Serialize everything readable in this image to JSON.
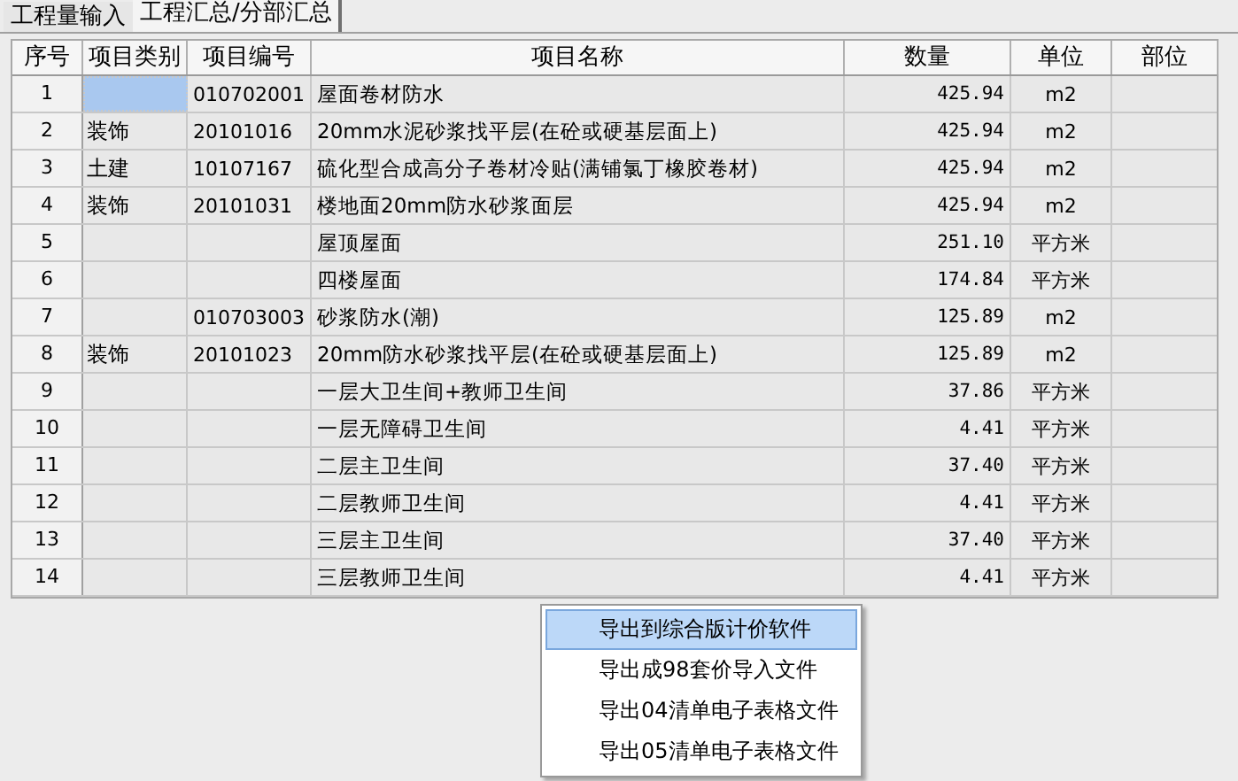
{
  "tabs": [
    {
      "label": "工程量输入",
      "selected": false
    },
    {
      "label": "工程汇总/分部汇总",
      "selected": true
    }
  ],
  "table": {
    "columns": [
      "序号",
      "项目类别",
      "项目编号",
      "项目名称",
      "数量",
      "单位",
      "部位"
    ],
    "rows": [
      {
        "seq": "1",
        "category": "",
        "code": "010702001",
        "name": "屋面卷材防水",
        "quantity": "425.94",
        "unit": "m2",
        "selected": true
      },
      {
        "seq": "2",
        "category": "装饰",
        "code": "20101016",
        "name": "20mm水泥砂浆找平层(在砼或硬基层面上)",
        "quantity": "425.94",
        "unit": "m2",
        "selected": false
      },
      {
        "seq": "3",
        "category": "土建",
        "code": "10107167",
        "name": "硫化型合成高分子卷材冷贴(满铺氯丁橡胶卷材)",
        "quantity": "425.94",
        "unit": "m2",
        "selected": false
      },
      {
        "seq": "4",
        "category": "装饰",
        "code": "20101031",
        "name": "楼地面20mm防水砂浆面层",
        "quantity": "425.94",
        "unit": "m2",
        "selected": false
      },
      {
        "seq": "5",
        "category": "",
        "code": "",
        "name": "屋顶屋面",
        "quantity": "251.10",
        "unit": "平方米",
        "selected": false
      },
      {
        "seq": "6",
        "category": "",
        "code": "",
        "name": "四楼屋面",
        "quantity": "174.84",
        "unit": "平方米",
        "selected": false
      },
      {
        "seq": "7",
        "category": "",
        "code": "010703003",
        "name": "砂浆防水(潮)",
        "quantity": "125.89",
        "unit": "m2",
        "selected": false
      },
      {
        "seq": "8",
        "category": "装饰",
        "code": "20101023",
        "name": "20mm防水砂浆找平层(在砼或硬基层面上)",
        "quantity": "125.89",
        "unit": "m2",
        "selected": false
      },
      {
        "seq": "9",
        "category": "",
        "code": "",
        "name": "一层大卫生间+教师卫生间",
        "quantity": "37.86",
        "unit": "平方米",
        "selected": false
      },
      {
        "seq": "10",
        "category": "",
        "code": "",
        "name": "一层无障碍卫生间",
        "quantity": "4.41",
        "unit": "平方米",
        "selected": false
      },
      {
        "seq": "11",
        "category": "",
        "code": "",
        "name": "二层主卫生间",
        "quantity": "37.40",
        "unit": "平方米",
        "selected": false
      },
      {
        "seq": "12",
        "category": "",
        "code": "",
        "name": "二层教师卫生间",
        "quantity": "4.41",
        "unit": "平方米",
        "selected": false
      },
      {
        "seq": "13",
        "category": "",
        "code": "",
        "name": "三层主卫生间",
        "quantity": "37.40",
        "unit": "平方米",
        "selected": false
      },
      {
        "seq": "14",
        "category": "",
        "code": "",
        "name": "三层教师卫生间",
        "quantity": "4.41",
        "unit": "平方米",
        "selected": false
      }
    ]
  },
  "context_menu": {
    "items": [
      {
        "label": "导出到综合版计价软件",
        "selected": true
      },
      {
        "label": "导出成98套价导入文件",
        "selected": false
      },
      {
        "label": "导出04清单电子表格文件",
        "selected": false
      },
      {
        "label": "导出05清单电子表格文件",
        "selected": false
      }
    ]
  }
}
